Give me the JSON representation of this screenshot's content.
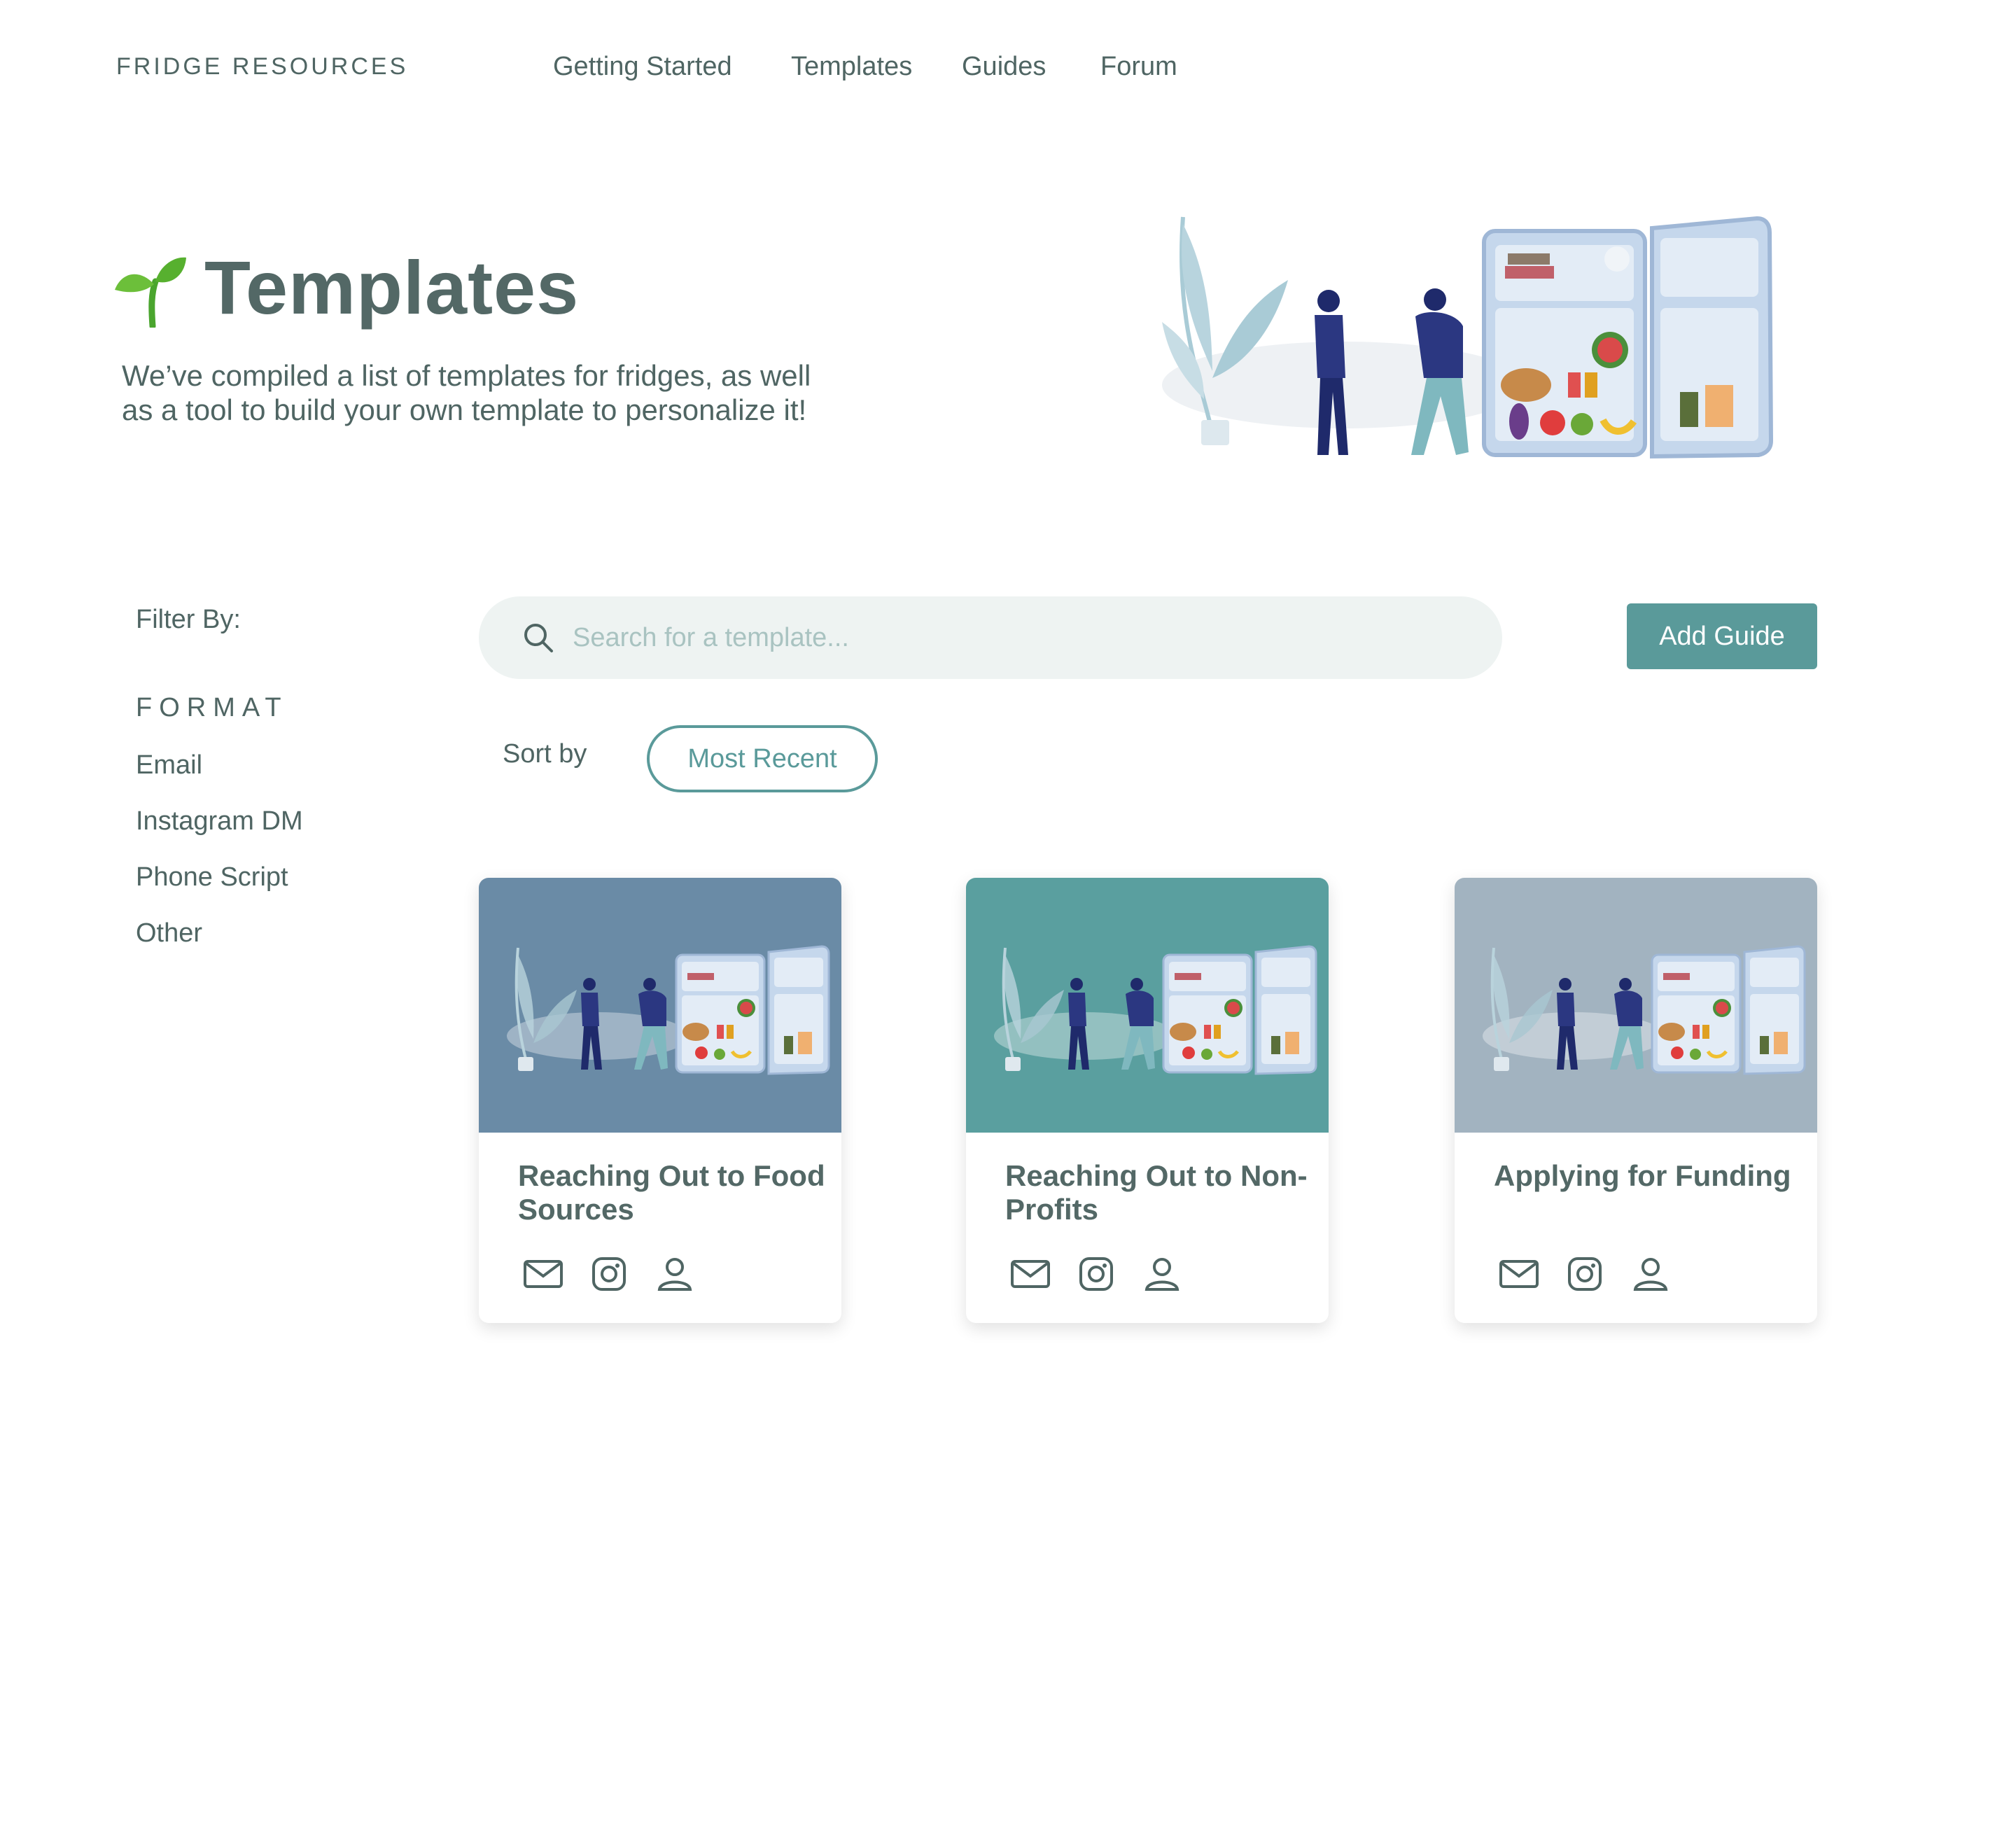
{
  "brand": "FRIDGE RESOURCES",
  "nav": [
    {
      "label": "Getting Started"
    },
    {
      "label": "Templates"
    },
    {
      "label": "Guides"
    },
    {
      "label": "Forum"
    }
  ],
  "hero": {
    "title": "Templates",
    "description": "We’ve compiled a list of templates for fridges, as well as a tool to build your own template to personalize it!",
    "icon": "sprout-icon"
  },
  "filters": {
    "heading": "Filter By:",
    "group_label": "FORMAT",
    "items": [
      {
        "label": "Email"
      },
      {
        "label": "Instagram DM"
      },
      {
        "label": "Phone Script"
      },
      {
        "label": "Other"
      }
    ]
  },
  "search": {
    "placeholder": "Search for a template...",
    "value": ""
  },
  "add_guide_label": "Add Guide",
  "sort": {
    "label": "Sort by",
    "selected": "Most Recent"
  },
  "cards": [
    {
      "title": "Reaching Out to Food Sources",
      "bg_color": "#6a8ba6",
      "icons": [
        "mail-icon",
        "instagram-icon",
        "person-icon"
      ]
    },
    {
      "title": "Reaching Out to Non-Profits",
      "bg_color": "#5a9f9f",
      "icons": [
        "mail-icon",
        "instagram-icon",
        "person-icon"
      ]
    },
    {
      "title": "Applying for Funding",
      "bg_color": "#a2b3c0",
      "icons": [
        "mail-icon",
        "instagram-icon",
        "person-icon"
      ]
    }
  ],
  "colors": {
    "accent": "#5a9a9a",
    "text": "#4f6563",
    "search_bg": "#eef3f2"
  }
}
